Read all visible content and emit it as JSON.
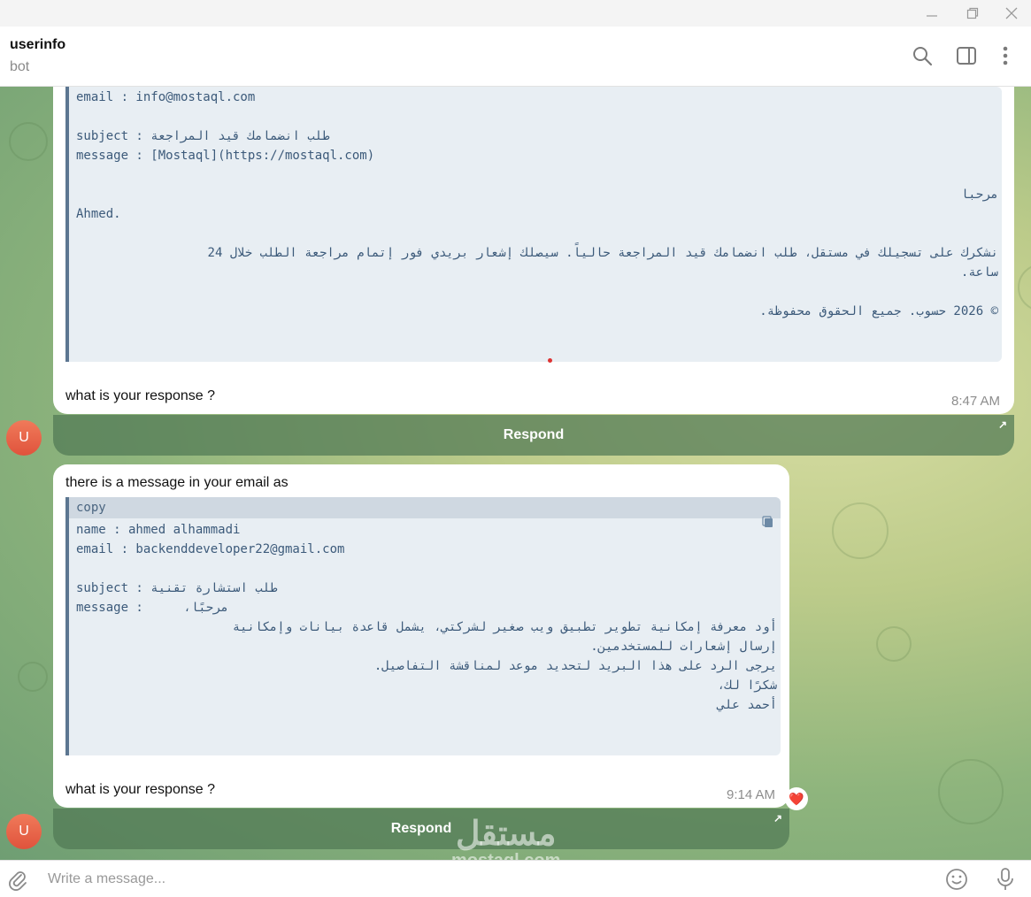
{
  "header": {
    "title": "userinfo",
    "subtitle": "bot"
  },
  "msg1": {
    "code_lines": [
      "email : info@mostaql.com",
      "",
      "subject : طلب انضمامك قيد المراجعة",
      "message : [Mostaql](https://mostaql.com)"
    ],
    "rtl_greeting": "مرحبا",
    "name_line": "Ahmed.",
    "rtl_body_1": "نشكرك على تسجيلك في مستقل، طلب انضمامك قيد المراجعة حالياً. سيصلك إشعار بريدي فور إتمام مراجعة الطلب خلال 24",
    "rtl_body_2": "ساعة.",
    "rtl_footer": "© 2026 حسوب. جميع الحقوق محفوظة.",
    "question": "what is your response ?",
    "time": "8:47 AM",
    "button": "Respond"
  },
  "msg2": {
    "intro": "there is a message in your email as",
    "copy_label": "copy",
    "name_line": "name : ahmed alhammadi",
    "email_line": "email : backenddeveloper22@gmail.com",
    "subject_line": "subject : طلب استشارة تقنية",
    "message_label": "message :",
    "message_greeting": "مرحبًا،",
    "body_lines": [
      "أود معرفة إمكانية تطوير تطبيق ويب صغير لشركتي، يشمل قاعدة بيانات وإمكانية",
      "إرسال إشعارات للمستخدمين.",
      "يرجى الرد على هذا البريد لتحديد موعد لمناقشة التفاصيل.",
      "شكرًا لك،",
      "أحمد علي"
    ],
    "question": "what is your response ?",
    "time": "9:14 AM",
    "reaction": "❤️",
    "button": "Respond"
  },
  "avatar_letter": "U",
  "composer": {
    "placeholder": "Write a message..."
  },
  "watermark": {
    "arabic": "مستقل",
    "latin": "mostaql.com"
  }
}
